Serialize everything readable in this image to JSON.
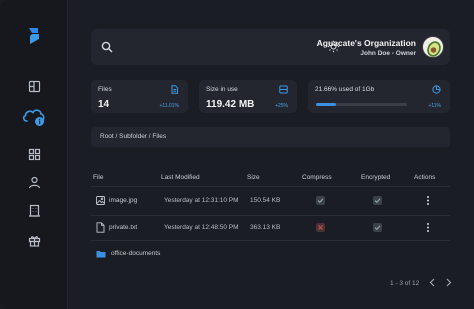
{
  "org": {
    "name": "Aguacate's Organization",
    "user": "John Doe - Owner"
  },
  "stats": [
    {
      "label": "Files",
      "value": "14",
      "trend": "+11.01%",
      "icon": "document-icon"
    },
    {
      "label": "Size in use",
      "value": "119.42 MB",
      "trend": "+25%",
      "icon": "storage-icon"
    },
    {
      "label": "21.66% used of 1Gb",
      "trend": "+11%",
      "icon": "pie-chart-icon",
      "progress_percent": 21.66
    }
  ],
  "breadcrumb": "Root / Subfolder / Files",
  "table": {
    "columns": [
      "File",
      "Last Modified",
      "Size",
      "Compress",
      "Encrypted",
      "Actions"
    ],
    "rows": [
      {
        "name": "image.jpg",
        "modified": "Yesterday at 12:31:10 PM",
        "size": "150.54 KB",
        "compress": true,
        "encrypted": true,
        "icon": "image-icon"
      },
      {
        "name": "private.txt",
        "modified": "Yesterday at 12:48:50 PM",
        "size": "363.13 KB",
        "compress": false,
        "encrypted": true,
        "icon": "text-file-icon"
      }
    ],
    "folder": {
      "name": "office-documents",
      "icon": "folder-icon"
    }
  },
  "pagination": {
    "text": "1 - 3 of 12"
  },
  "colors": {
    "accent": "#3d9ae6",
    "background": "#1b1d24",
    "panel": "#23262e",
    "sidebar": "#16181e",
    "danger": "#c0504d",
    "check": "#8fa39a"
  }
}
